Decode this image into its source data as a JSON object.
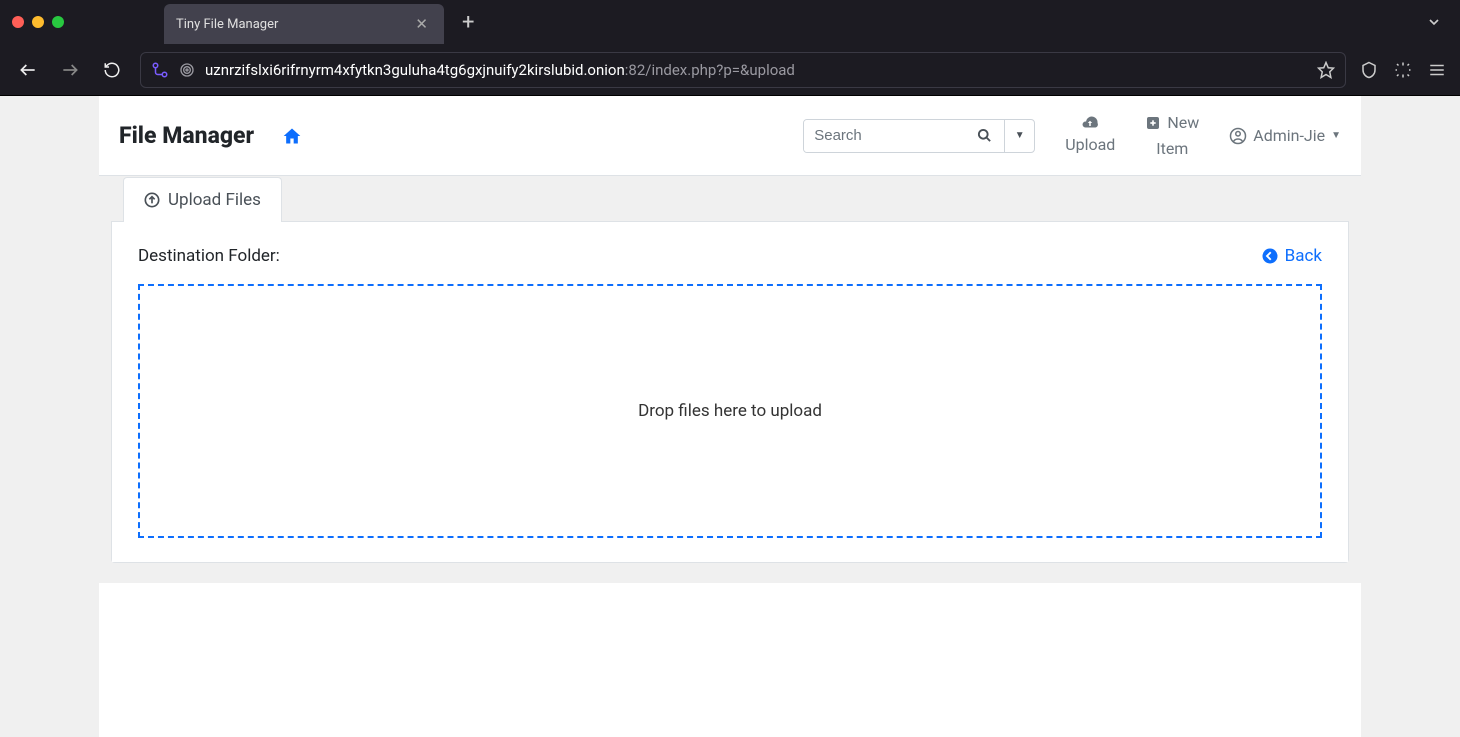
{
  "browser": {
    "tab_title": "Tiny File Manager",
    "url_host": "uznrzifslxi6rifrnyrm4xfytkn3guluha4tg6gxjnuify2kirslubid.onion",
    "url_rest": ":82/index.php?p=&upload"
  },
  "navbar": {
    "brand": "File Manager",
    "search_placeholder": "Search",
    "upload_label": "Upload",
    "new_item_label_1": "New",
    "new_item_label_2": "Item",
    "user_label": "Admin-Jie"
  },
  "page": {
    "tab_label": "Upload Files",
    "destination_label": "Destination Folder:",
    "back_label": "Back",
    "dropzone_text": "Drop files here to upload"
  }
}
